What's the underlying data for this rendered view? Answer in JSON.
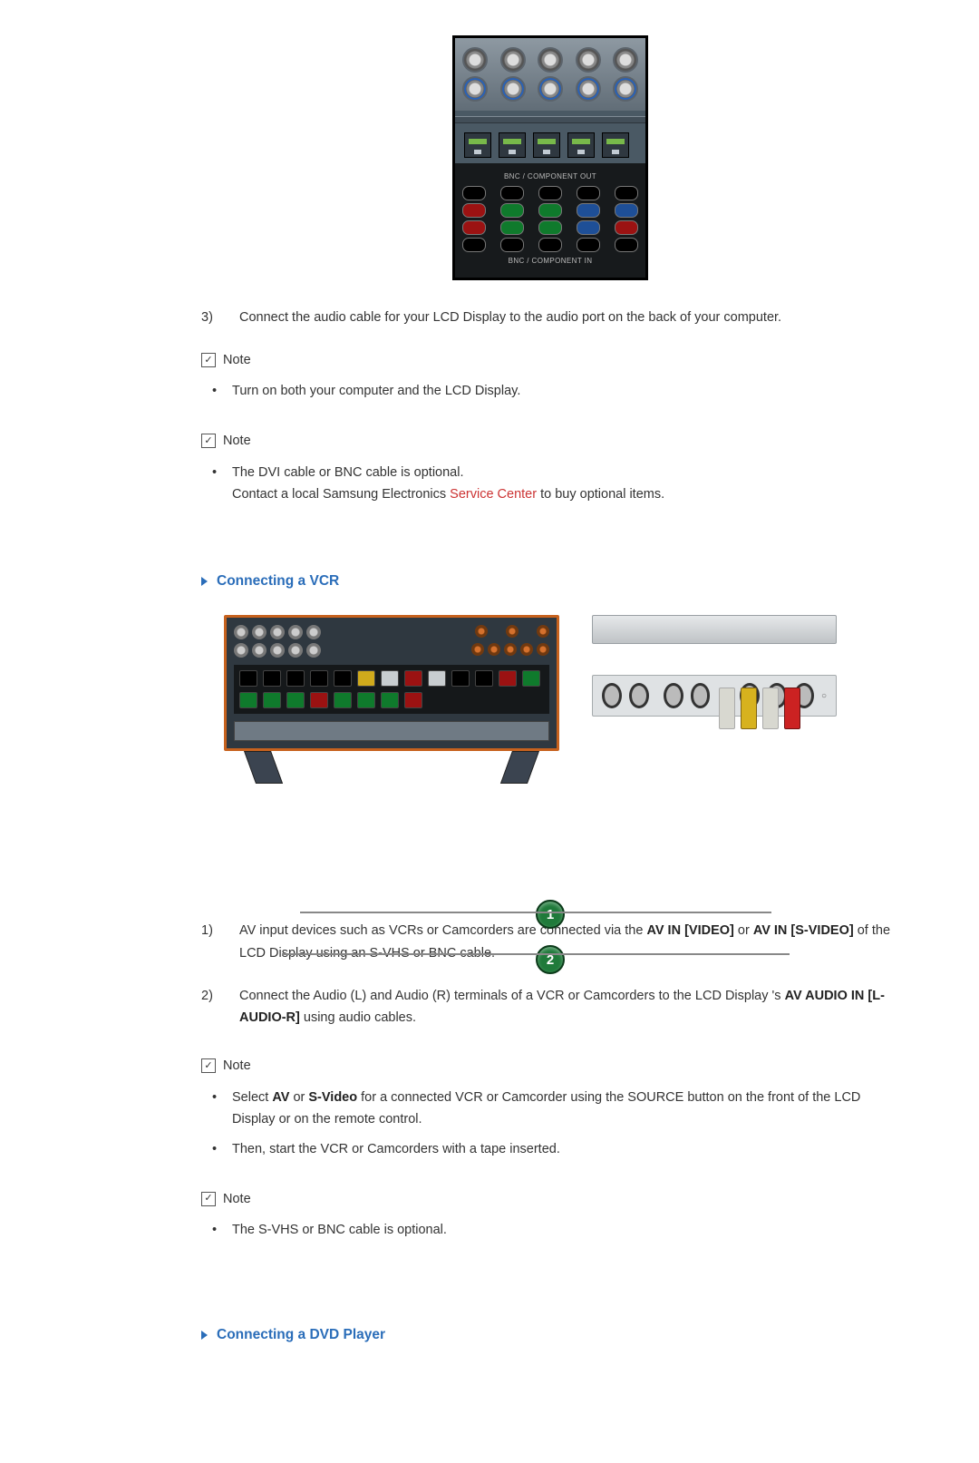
{
  "step3": {
    "num": "3)",
    "text": "Connect the audio cable for your LCD Display to the audio port on the back of your computer."
  },
  "note_label": "Note",
  "note1_items": [
    "Turn on both your computer and the LCD Display."
  ],
  "note2_line1": "The DVI cable or BNC cable is optional.",
  "note2_line2_pre": "Contact a local Samsung Electronics ",
  "note2_link": "Service Center",
  "note2_line2_post": " to buy optional items.",
  "vcr_heading": "Connecting a VCR",
  "vcr_step1": {
    "num": "1)",
    "pre": "AV input devices such as VCRs or Camcorders are connected via the ",
    "b1": "AV IN [VIDEO]",
    "mid": " or ",
    "b2": "AV IN [S-VIDEO]",
    "post": " of the LCD Display using an S-VHS or BNC cable."
  },
  "vcr_step2": {
    "num": "2)",
    "pre": "Connect the Audio (L) and Audio (R) terminals of a VCR or Camcorders to the LCD Display 's ",
    "b1": "AV AUDIO IN [L-AUDIO-R]",
    "post": " using audio cables."
  },
  "note3_item_pre": "Select ",
  "note3_b1": "AV",
  "note3_mid": " or ",
  "note3_b2": "S-Video",
  "note3_item_post": " for a connected VCR or Camcorder using the SOURCE button on the front of the LCD Display or on the remote control.",
  "note3_item2": "Then, start the VCR or Camcorders with a tape inserted.",
  "note4_item": "The S-VHS or BNC cable is optional.",
  "dvd_heading": "Connecting a DVD Player",
  "badge1": "1",
  "badge2": "2",
  "fig1_label_top": "BNC / COMPONENT OUT",
  "fig1_label_bot": "BNC / COMPONENT IN"
}
